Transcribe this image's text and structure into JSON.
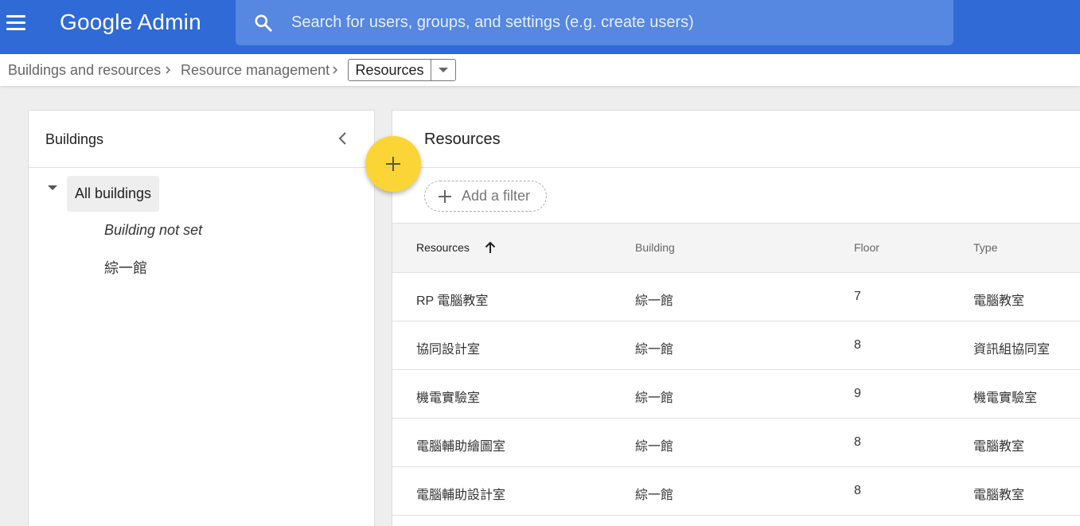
{
  "header": {
    "logo_google": "Google",
    "logo_admin": "Admin",
    "search_placeholder": "Search for users, groups, and settings (e.g. create users)"
  },
  "breadcrumb": {
    "items": [
      "Buildings and resources",
      "Resource management"
    ],
    "current": "Resources"
  },
  "buildings_panel": {
    "title": "Buildings",
    "all_label": "All buildings",
    "items": [
      "Building not set",
      "綜一館"
    ]
  },
  "resources_panel": {
    "title": "Resources",
    "add_filter": "Add a filter",
    "columns": [
      "Resources",
      "Building",
      "Floor",
      "Type"
    ],
    "rows": [
      [
        "RP 電腦教室",
        "綜一館",
        "7",
        "電腦教室"
      ],
      [
        "協同設計室",
        "綜一館",
        "8",
        "資訊組協同室"
      ],
      [
        "機電實驗室",
        "綜一館",
        "9",
        "機電實驗室"
      ],
      [
        "電腦輔助繪圖室",
        "綜一館",
        "8",
        "電腦教室"
      ],
      [
        "電腦輔助設計室",
        "綜一館",
        "8",
        "電腦教室"
      ]
    ]
  },
  "colors": {
    "topbar": "#2f6ad6",
    "search_bg": "#5687e1",
    "fab": "#fbd535"
  },
  "icons": [
    "menu-icon",
    "search-icon",
    "chevron-right-icon",
    "dropdown-arrow-icon",
    "chevron-left-icon",
    "add-icon",
    "sort-ascending-icon"
  ]
}
